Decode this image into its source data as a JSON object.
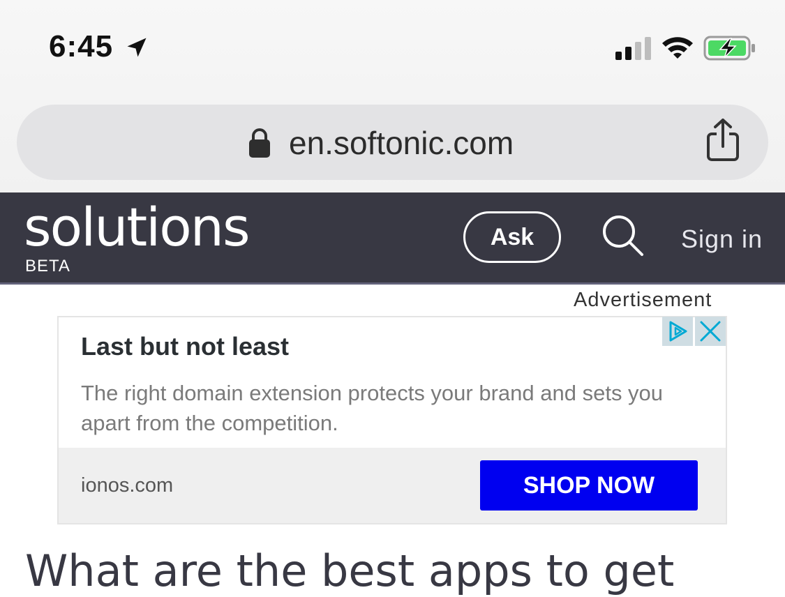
{
  "status_bar": {
    "time": "6:45",
    "icons": [
      "location-arrow-icon",
      "signal-icon",
      "wifi-icon",
      "battery-charging-icon"
    ]
  },
  "browser": {
    "url": "en.softonic.com",
    "icons": [
      "lock-icon",
      "share-icon"
    ]
  },
  "site_header": {
    "logo": "solutions",
    "logo_sub": "BETA",
    "ask_label": "Ask",
    "signin_label": "Sign in",
    "icons": [
      "search-icon"
    ]
  },
  "ad": {
    "label": "Advertisement",
    "title": "Last but not least",
    "body": "The right domain extension protects your brand and sets you apart from the competition.",
    "domain": "ionos.com",
    "cta": "SHOP NOW",
    "cta_color": "#0000f0",
    "icons": [
      "adchoices-icon",
      "close-icon"
    ]
  },
  "article": {
    "headline": "What are the best apps to get"
  },
  "colors": {
    "header_bg": "#383843",
    "url_bar_bg": "#e3e3e5",
    "battery_fill": "#4cd964"
  }
}
